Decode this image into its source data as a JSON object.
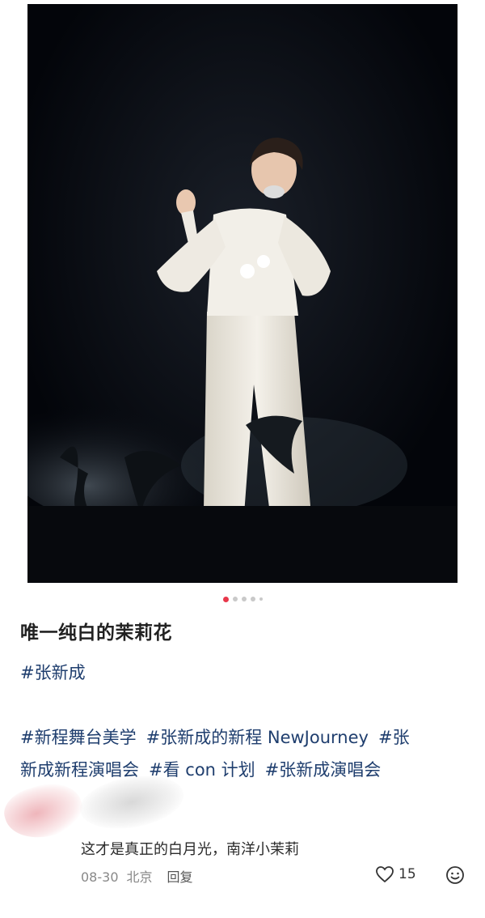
{
  "post": {
    "photo_alt": "performer in white singing on dark stage",
    "carousel": {
      "total": 5,
      "active_index": 0
    },
    "title": "唯一纯白的茉莉花",
    "primary_tag": "#张新成",
    "tags_line1": [
      "#新程舞台美学",
      "#张新成的新程 NewJourney",
      "#张"
    ],
    "tags_line2": [
      "新成新程演唱会",
      "#看 con 计划",
      "#张新成演唱会"
    ]
  },
  "comment": {
    "text": "这才是真正的白月光，南洋小茉莉",
    "date": "08-30",
    "location": "北京",
    "reply_label": "回复",
    "like_count": "15",
    "like_icon": "heart-outline-icon",
    "emoji_icon": "smiley-icon"
  },
  "colors": {
    "tag": "#1f3e6e",
    "active_dot": "#e8374b"
  }
}
